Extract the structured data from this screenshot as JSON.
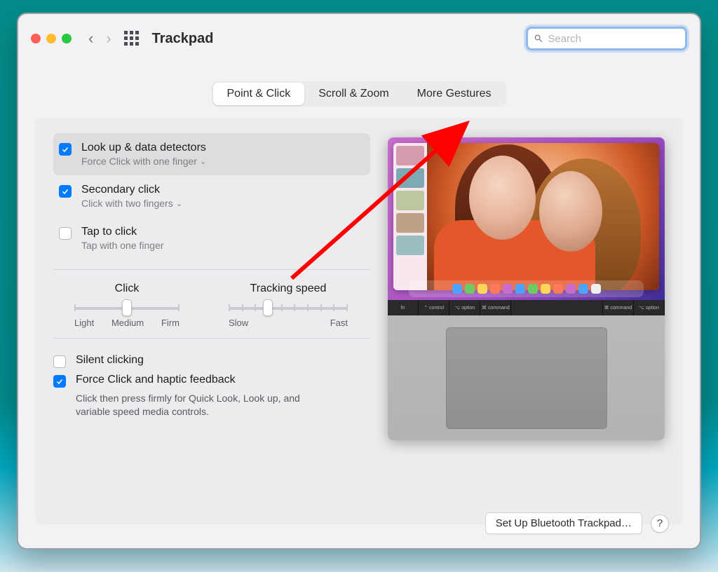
{
  "window": {
    "title": "Trackpad"
  },
  "search": {
    "placeholder": "Search",
    "value": ""
  },
  "tabs": {
    "items": [
      {
        "label": "Point & Click",
        "active": true
      },
      {
        "label": "Scroll & Zoom",
        "active": false
      },
      {
        "label": "More Gestures",
        "active": false
      }
    ]
  },
  "options": {
    "lookup": {
      "title": "Look up & data detectors",
      "sub": "Force Click with one finger",
      "checked": true,
      "selected": true
    },
    "secondary": {
      "title": "Secondary click",
      "sub": "Click with two fingers",
      "checked": true
    },
    "tap": {
      "title": "Tap to click",
      "sub": "Tap with one finger",
      "checked": false
    }
  },
  "sliders": {
    "click": {
      "label": "Click",
      "left": "Light",
      "mid": "Medium",
      "right": "Firm",
      "ticks": 3,
      "value": 1
    },
    "tracking": {
      "label": "Tracking speed",
      "left": "Slow",
      "right": "Fast",
      "ticks": 10,
      "value": 3
    }
  },
  "bottom": {
    "silent": {
      "label": "Silent clicking",
      "checked": false
    },
    "force": {
      "label": "Force Click and haptic feedback",
      "checked": true,
      "desc": "Click then press firmly for Quick Look, Look up, and variable speed media controls."
    }
  },
  "footer": {
    "setup": "Set Up Bluetooth Trackpad…",
    "help": "?"
  },
  "keyboard": {
    "k0": "fn",
    "k1": "⌃ control",
    "k2": "⌥ option",
    "k3": "⌘ command",
    "k4": "⌘ command",
    "k5": "⌥ option"
  },
  "annotation": {
    "target_tab": "More Gestures"
  }
}
